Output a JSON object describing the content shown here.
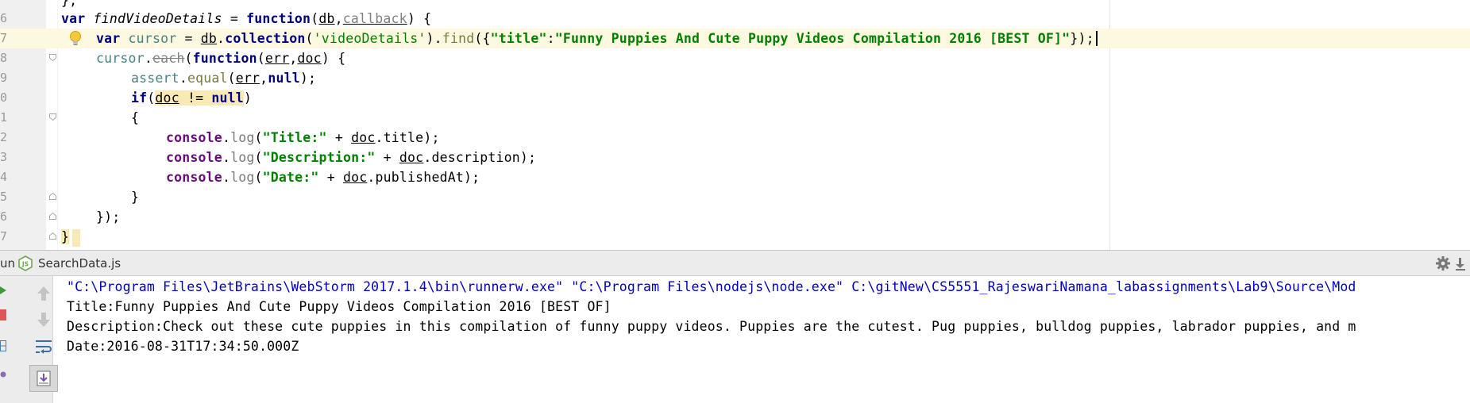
{
  "editor": {
    "lines": [
      {
        "num": "6",
        "text": "var findVideoDetails = function(db,callback) {"
      },
      {
        "num": "7",
        "text": "var cursor = db.collection('videoDetails').find({\"title\":\"Funny Puppies And Cute Puppy Videos Compilation 2016 [BEST OF]\"});"
      },
      {
        "num": "8",
        "text": "cursor.each(function(err,doc) {"
      },
      {
        "num": "9",
        "text": "assert.equal(err,null);"
      },
      {
        "num": "0",
        "text": "if(doc != null)"
      },
      {
        "num": "1",
        "text": "{"
      },
      {
        "num": "2",
        "text": "console.log(\"Title:\" + doc.title);"
      },
      {
        "num": "3",
        "text": "console.log(\"Description:\" + doc.description);"
      },
      {
        "num": "4",
        "text": "console.log(\"Date:\" + doc.publishedAt);"
      },
      {
        "num": "5",
        "text": "}"
      },
      {
        "num": "6",
        "text": "});"
      },
      {
        "num": "7",
        "text": "}"
      }
    ]
  },
  "runbar": {
    "label": "un",
    "file": "SearchData.js",
    "icons": [
      "node-js-icon",
      "gear-icon",
      "pin-icon"
    ]
  },
  "console": {
    "command": "\"C:\\Program Files\\JetBrains\\WebStorm 2017.1.4\\bin\\runnerw.exe\" \"C:\\Program Files\\nodejs\\node.exe\" C:\\gitNew\\CS5551_RajeswariNamana_labassignments\\Lab9\\Source\\Mod",
    "title": "Title:Funny Puppies And Cute Puppy Videos Compilation 2016 [BEST OF]",
    "description": "Description:Check out these cute puppies in this compilation of funny puppy videos. Puppies are the cutest. Pug puppies, bulldog puppies, labrador puppies, and m",
    "date": "Date:2016-08-31T17:34:50.000Z",
    "toolbar_icons": [
      "rerun-icon",
      "stop-icon",
      "up-arrow-icon",
      "down-arrow-icon",
      "layout-icon",
      "soft-wrap-icon",
      "scroll-to-end-icon"
    ]
  },
  "colors": {
    "keyword": "#000080",
    "string": "#008000",
    "current_line": "#fdf8e0",
    "console_command": "#0000c0"
  }
}
